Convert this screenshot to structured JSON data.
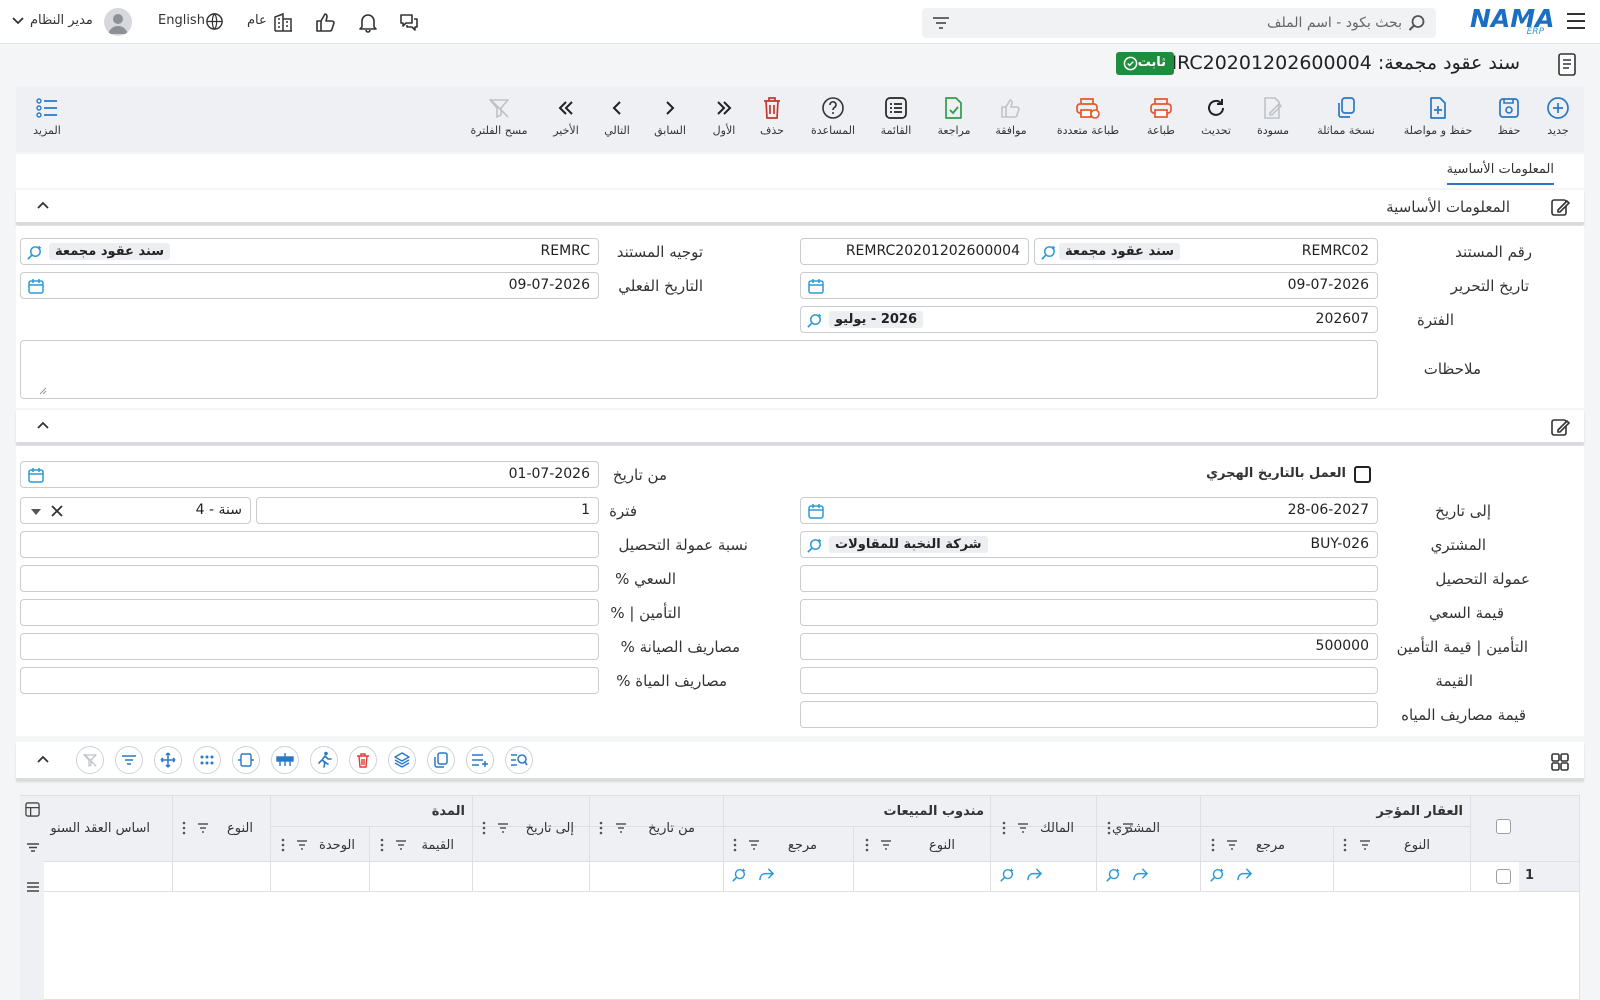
{
  "topbar": {
    "logo_text": "NAMA",
    "logo_sub": "ERP",
    "search_placeholder": "بحث بكود - اسم الملف",
    "user_name": "مدير النظام",
    "language": "English",
    "branch": "عام"
  },
  "title": {
    "text": "سند عقود مجمعة: REMRC20201202600004",
    "status": "ثابت"
  },
  "toolbar": [
    {
      "label": "جديد",
      "icon": "plus-circle-icon"
    },
    {
      "label": "حفظ",
      "icon": "save-icon"
    },
    {
      "label": "حفظ و مواصلة",
      "icon": "save-continue-icon"
    },
    {
      "label": "نسخة مماثلة",
      "icon": "duplicate-icon"
    },
    {
      "label": "مسودة",
      "icon": "draft-icon"
    },
    {
      "label": "تحديث",
      "icon": "refresh-icon"
    },
    {
      "label": "طباعة",
      "icon": "print-icon"
    },
    {
      "label": "طباعة متعددة",
      "icon": "multi-print-icon"
    },
    {
      "label": "موافقة",
      "icon": "approve-icon"
    },
    {
      "label": "مراجعة",
      "icon": "review-icon"
    },
    {
      "label": "القائمة",
      "icon": "list-icon"
    },
    {
      "label": "المساعدة",
      "icon": "help-icon"
    },
    {
      "label": "حذف",
      "icon": "delete-icon"
    },
    {
      "label": "الأول",
      "icon": "first-icon"
    },
    {
      "label": "السابق",
      "icon": "previous-icon"
    },
    {
      "label": "التالي",
      "icon": "next-icon"
    },
    {
      "label": "الأخير",
      "icon": "last-icon"
    },
    {
      "label": "مسح الفلترة",
      "icon": "clear-filter-icon"
    }
  ],
  "more_label": "المزيد",
  "tabs": {
    "basic": "المعلومات الأساسية"
  },
  "section1": {
    "title": "المعلومات الأساسية",
    "doc_number_label": "رقم المستند",
    "doc_number_code": "REMRC02",
    "doc_number_type": "سند عقود مجمعة",
    "doc_number_value": "REMRC20201202600004",
    "direction_label": "توجيه المستند",
    "direction_code": "REMRC",
    "direction_type": "سند عقود مجمعة",
    "edit_date_label": "تاريخ التحرير",
    "edit_date": "09-07-2026",
    "actual_date_label": "التاريخ الفعلي",
    "actual_date": "09-07-2026",
    "period_label": "الفترة",
    "period_code": "202607",
    "period_name": "2026 - يوليو",
    "notes_label": "ملاحظات",
    "notes": ""
  },
  "section2": {
    "hijri_label": "العمل بالتاريخ الهجري",
    "from_date_label": "من تاريخ",
    "from_date": "01-07-2026",
    "to_date_label": "إلى تاريخ",
    "to_date": "28-06-2027",
    "period_label": "فترة",
    "period_value": "1",
    "period_unit": "4 - سنة",
    "buyer_label": "المشتري",
    "buyer_code": "BUY-026",
    "buyer_name": "شركة النخبة للمقاولات",
    "collection_rate_label": "نسبة عمولة التحصيل",
    "collection_label": "عمولة التحصيل",
    "effort_pct_label": "السعي %",
    "effort_value_label": "قيمة السعي",
    "insurance_pct_label": "التأمين | %",
    "insurance_value_label": "التأمين | قيمة التأمين",
    "insurance_value": "500000",
    "maintenance_pct_label": "مصاريف الصيانة %",
    "value_label": "القيمة",
    "water_pct_label": "مصاريف المياة %",
    "water_value_label": "قيمة مصاريف المياه"
  },
  "grid": {
    "groups": {
      "property": "العقار المؤجر",
      "sales_rep": "مندوب المبيعات",
      "duration": "المدة"
    },
    "columns": {
      "type": "النوع",
      "ref": "مرجع",
      "buyer": "المشتري",
      "owner": "المالك",
      "rep_type": "النوع",
      "rep_ref": "مرجع",
      "from_date": "من تاريخ",
      "to_date": "إلى تاريخ",
      "value": "القيمة",
      "unit": "الوحدة",
      "type2": "النوع",
      "annual_basis": "اساس العقد السنو"
    },
    "rows": [
      {
        "num": "1"
      }
    ]
  }
}
